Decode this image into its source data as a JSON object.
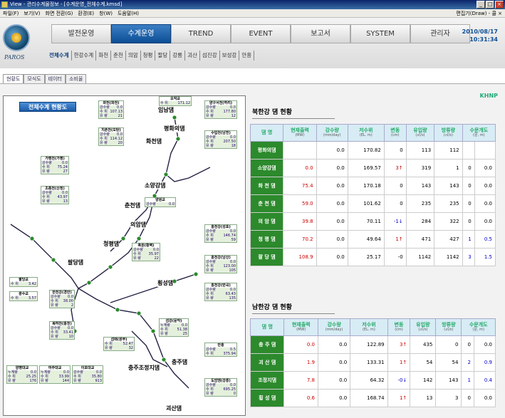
{
  "window": {
    "title": "View - 관리수계물정보 - [수계운영_전체수계.kmsd]"
  },
  "menu": {
    "items": [
      "파일(F)",
      "보기(V)",
      "화면 전환(G)",
      "환경(E)",
      "창(W)",
      "도움말(H)"
    ],
    "right": "편집기(Draw) - 콜 ×"
  },
  "header": {
    "logo_text": "PAROS",
    "tabs": [
      "발전운영",
      "수계운영",
      "TREND",
      "EVENT",
      "보고서",
      "SYSTEM",
      "관리자"
    ],
    "active_tab": "수계운영",
    "date": "2010/08/17",
    "time": "10:31:34",
    "subnav": [
      "전체수계",
      "한강수계",
      "화천",
      "춘천",
      "의암",
      "청평",
      "팔당",
      "강릉",
      "괴산",
      "섬진강",
      "보성강",
      "안흥"
    ]
  },
  "toolbar": {
    "items": [
      "현황도",
      "모식도",
      "테이터",
      "소비율"
    ]
  },
  "map": {
    "title": "전체수계 현황도",
    "dam_labels": [
      "임남댐",
      "평화의댐",
      "화천댐",
      "소양강댐",
      "춘천댐",
      "의암댐",
      "청평댐",
      "팔당댐",
      "횡성댐",
      "충주댐",
      "충주조정지댐",
      "괴산댐"
    ],
    "boxes": [
      {
        "name": "화천(화천)",
        "rows": [
          [
            "강수량",
            "0.0"
          ],
          [
            "수 위",
            "107.13"
          ],
          [
            "유 량",
            "21"
          ]
        ]
      },
      {
        "name": "오작교",
        "rows": [
          [
            "수 위",
            "171.12"
          ]
        ]
      },
      {
        "name": "양구서천(하리)",
        "rows": [
          [
            "강수량",
            "0.0"
          ],
          [
            "수 위",
            "177.80"
          ],
          [
            "유 량",
            "12"
          ]
        ]
      },
      {
        "name": "지촌천(오탄)",
        "rows": [
          [
            "강수량",
            "0.0"
          ],
          [
            "수 위",
            "114.12"
          ],
          [
            "유 량",
            "20"
          ]
        ]
      },
      {
        "name": "수입천(남전)",
        "rows": [
          [
            "강수량",
            "0.0"
          ],
          [
            "수 위",
            "207.50"
          ],
          [
            "유 량",
            "18"
          ]
        ]
      },
      {
        "name": "가평천(가평)",
        "rows": [
          [
            "강수량",
            "0.0"
          ],
          [
            "수 위",
            "75.24"
          ],
          [
            "유 량",
            "27"
          ]
        ]
      },
      {
        "name": "조종천(산정)",
        "rows": [
          [
            "강수량",
            "0.0"
          ],
          [
            "수 위",
            "43.97"
          ],
          [
            "유 량",
            "13"
          ]
        ]
      },
      {
        "name": "양원교",
        "rows": [
          [
            "강수량",
            "0.0"
          ]
        ]
      },
      {
        "name": "홍천강(성포)",
        "rows": [
          [
            "강수량",
            "0.0"
          ],
          [
            "수 위",
            "146.74"
          ],
          [
            "유 량",
            "59"
          ]
        ]
      },
      {
        "name": "흑원(황벽)",
        "rows": [
          [
            "강수량",
            "0.0"
          ],
          [
            "수 위",
            "35.97"
          ],
          [
            "유 량",
            "22"
          ]
        ]
      },
      {
        "name": "홍천강(남산)",
        "rows": [
          [
            "강수량",
            "0.0"
          ],
          [
            "수 위",
            "123.00"
          ],
          [
            "유 량",
            "105"
          ]
        ]
      },
      {
        "name": "홍천강(반곡)",
        "rows": [
          [
            "강수량",
            "0.0"
          ],
          [
            "수 위",
            "63.43"
          ],
          [
            "유 량",
            "135"
          ]
        ]
      },
      {
        "name": "팔당교",
        "rows": [
          [
            "수 위",
            "3.42"
          ]
        ]
      },
      {
        "name": "광수교",
        "rows": [
          [
            "수 위",
            "3.57"
          ]
        ]
      },
      {
        "name": "한천강(경안)",
        "rows": [
          [
            "강수량",
            "0.0"
          ],
          [
            "수 위",
            "38.00"
          ],
          [
            "유 량",
            "2"
          ]
        ]
      },
      {
        "name": "복하천(흥천)",
        "rows": [
          [
            "강수량",
            "0.0"
          ],
          [
            "수 위",
            "33.41"
          ],
          [
            "유 량",
            "10"
          ]
        ]
      },
      {
        "name": "섬강(문막)",
        "rows": [
          [
            "누계량",
            "0.0"
          ],
          [
            "수 위",
            "51.38"
          ],
          [
            "유 량",
            "25"
          ]
        ]
      },
      {
        "name": "안흥",
        "rows": [
          [
            "강수량",
            "0.5"
          ],
          [
            "수 위",
            "375.94"
          ]
        ]
      },
      {
        "name": "섬매(원부)",
        "rows": [
          [
            "수 위",
            "52.47"
          ],
          [
            "유 량",
            "32"
          ]
        ]
      },
      {
        "name": "양평대교",
        "rows": [
          [
            "누계량",
            "0.0"
          ],
          [
            "수 위",
            "25.25"
          ],
          [
            "유 량",
            "176"
          ]
        ]
      },
      {
        "name": "여주대교",
        "rows": [
          [
            "누계량",
            "0.0"
          ],
          [
            "수 위",
            "33.99"
          ],
          [
            "유 량",
            "144"
          ]
        ]
      },
      {
        "name": "이포대교",
        "rows": [
          [
            "강수량",
            "0.0"
          ],
          [
            "수 위",
            "35.80"
          ],
          [
            "유 량",
            "913"
          ]
        ]
      },
      {
        "name": "도암댐(강릉)",
        "rows": [
          [
            "강수량",
            "0.0"
          ],
          [
            "수 위",
            "695.25"
          ],
          [
            "유 량",
            "0"
          ]
        ]
      }
    ]
  },
  "north": {
    "title": "북한강 댐 현황",
    "headers": [
      "댐 명",
      "현재출력",
      "강수량",
      "저수위",
      "변동",
      "유입량",
      "방류량",
      "수문개도"
    ],
    "units": [
      "",
      "(MW)",
      "(mm/day)",
      "(EL. m)",
      "(cm)",
      "(㎥/s)",
      "(㎥/s)",
      "(문, m)"
    ],
    "rows": [
      [
        "평화의댐",
        "",
        "0.0",
        "170.82",
        "0",
        "113",
        "112",
        "",
        ""
      ],
      [
        "소양강댐",
        "0.0",
        "0.0",
        "169.57",
        "3↑",
        "319",
        "1",
        "0",
        "0.0"
      ],
      [
        "화 천 댐",
        "75.4",
        "0.0",
        "170.18",
        "0",
        "143",
        "143",
        "0",
        "0.0"
      ],
      [
        "춘 천 댐",
        "59.0",
        "0.0",
        "101.62",
        "0",
        "235",
        "235",
        "0",
        "0.0"
      ],
      [
        "의 암 댐",
        "39.8",
        "0.0",
        "70.11",
        "-1↓",
        "284",
        "322",
        "0",
        "0.0"
      ],
      [
        "청 평 댐",
        "70.2",
        "0.0",
        "49.64",
        "1↑",
        "471",
        "427",
        "1",
        "0.5"
      ],
      [
        "팔 당 댐",
        "108.9",
        "0.0",
        "25.17",
        "-0",
        "1142",
        "1142",
        "3",
        "1.5"
      ]
    ]
  },
  "south": {
    "title": "남한강 댐 현황",
    "rows": [
      [
        "충 주 댐",
        "0.0",
        "0.0",
        "122.89",
        "3↑",
        "435",
        "0",
        "0",
        "0.0"
      ],
      [
        "괴 산 댐",
        "1.9",
        "0.0",
        "133.31",
        "1↑",
        "54",
        "54",
        "2",
        "0.9"
      ],
      [
        "조정지댐",
        "7.8",
        "0.0",
        "64.32",
        "-0↓",
        "142",
        "143",
        "1",
        "0.4"
      ],
      [
        "횡 성 댐",
        "0.6",
        "0.0",
        "168.74",
        "1↑",
        "13",
        "3",
        "0",
        "0.0"
      ]
    ]
  },
  "brand": "KHNP"
}
